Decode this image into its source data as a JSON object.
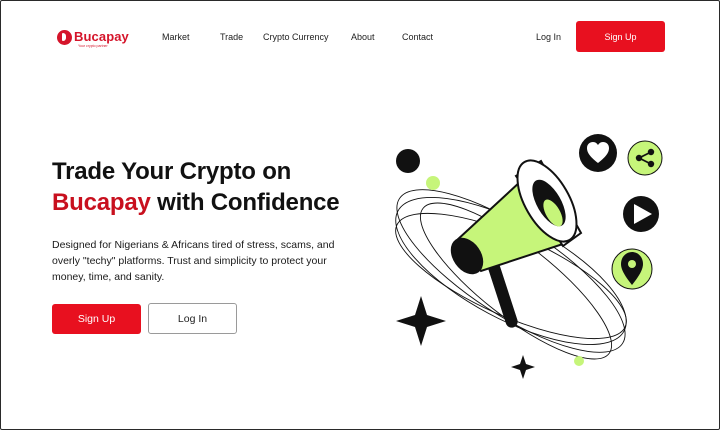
{
  "brand": {
    "name": "Bucapay",
    "tagline": "Your crypto partner",
    "color": "#d5142a"
  },
  "nav": {
    "items": [
      {
        "label": "Market"
      },
      {
        "label": "Trade"
      },
      {
        "label": "Crypto Currency"
      },
      {
        "label": "About"
      },
      {
        "label": "Contact"
      }
    ],
    "login_label": "Log In",
    "signup_label": "Sign Up"
  },
  "hero": {
    "title_line1": "Trade Your Crypto on",
    "title_brand": "Bucapay",
    "title_rest": "with Confidence",
    "description": "Designed for Nigerians & Africans tired of stress, scams, and overly \"techy\" platforms. Trust and simplicity to protect your money, time, and sanity.",
    "signup_label": "Sign Up",
    "login_label": "Log In"
  },
  "illustration": {
    "icons": [
      "megaphone-icon",
      "heart-icon",
      "share-icon",
      "play-icon",
      "location-pin-icon",
      "sparkle-star-icon"
    ],
    "accent_green": "#c6f57a",
    "accent_black": "#111111"
  },
  "colors": {
    "primary": "#e8101f",
    "text": "#111111"
  }
}
